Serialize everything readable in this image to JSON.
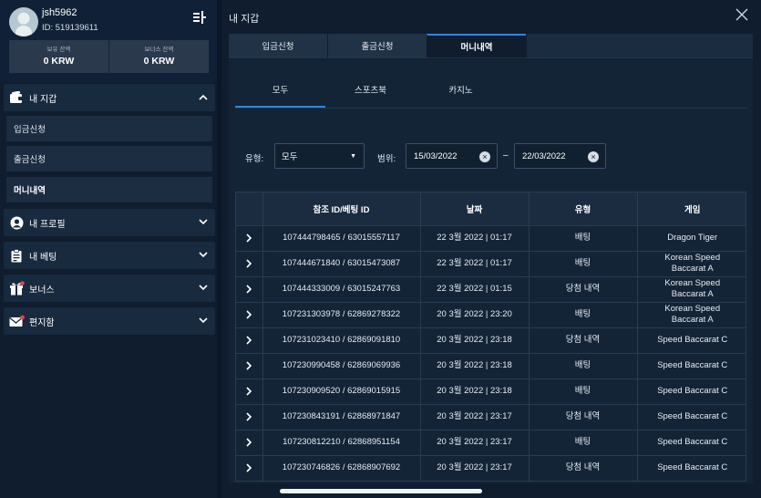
{
  "profile": {
    "username": "jsh5962",
    "user_id": "ID: 519139611",
    "balance_label": "보유 잔액",
    "balance_value": "0 KRW",
    "bonus_label": "보너스 잔액",
    "bonus_value": "0 KRW"
  },
  "sidebar": {
    "wallet": {
      "label": "내 지갑",
      "icon": "wallet-icon"
    },
    "wallet_items": [
      "입금신청",
      "출금신청",
      "머니내역"
    ],
    "menus": [
      {
        "label": "내 프로필",
        "icon": "user-icon"
      },
      {
        "label": "내 베팅",
        "icon": "clipboard-icon"
      },
      {
        "label": "보너스",
        "icon": "gift-icon"
      },
      {
        "label": "편지함",
        "icon": "mail-icon"
      }
    ]
  },
  "panel": {
    "title": "내 지갑",
    "tabs": [
      "입금신청",
      "출금신청",
      "머니내역"
    ],
    "active_tab": "머니내역",
    "subtabs": [
      "모두",
      "스포츠북",
      "카지노"
    ],
    "active_subtab": "모두"
  },
  "filters": {
    "type_label": "유형:",
    "type_value": "모두",
    "range_label": "범위:",
    "date_from": "15/03/2022",
    "date_to": "22/03/2022",
    "range_separator": "–"
  },
  "table": {
    "headers": [
      "참조 ID/베팅 ID",
      "날짜",
      "유형",
      "게임"
    ],
    "rows": [
      [
        "107444798465 / 63015557117",
        "22 3월 2022 | 01:17",
        "배팅",
        "Dragon Tiger"
      ],
      [
        "107444671840 / 63015473087",
        "22 3월 2022 | 01:17",
        "배팅",
        "Korean Speed\nBaccarat A"
      ],
      [
        "107444333009 / 63015247763",
        "22 3월 2022 | 01:15",
        "당첨 내역",
        "Korean Speed\nBaccarat A"
      ],
      [
        "107231303978 / 62869278322",
        "20 3월 2022 | 23:20",
        "배팅",
        "Korean Speed\nBaccarat A"
      ],
      [
        "107231023410 / 62869091810",
        "20 3월 2022 | 23:18",
        "당첨 내역",
        "Speed Baccarat C"
      ],
      [
        "107230990458 / 62869069936",
        "20 3월 2022 | 23:18",
        "배팅",
        "Speed Baccarat C"
      ],
      [
        "107230909520 / 62869015915",
        "20 3월 2022 | 23:18",
        "배팅",
        "Speed Baccarat C"
      ],
      [
        "107230843191 / 62868971847",
        "20 3월 2022 | 23:17",
        "당첨 내역",
        "Speed Baccarat C"
      ],
      [
        "107230812210 / 62868951154",
        "20 3월 2022 | 23:17",
        "배팅",
        "Speed Baccarat C"
      ],
      [
        "107230746826 / 62868907692",
        "20 3월 2022 | 23:17",
        "당첨 내역",
        "Speed Baccarat C"
      ]
    ]
  },
  "colors": {
    "accent": "#2f86e0",
    "background": "#0f1d2f",
    "sidebar": "#0f1d2e"
  }
}
